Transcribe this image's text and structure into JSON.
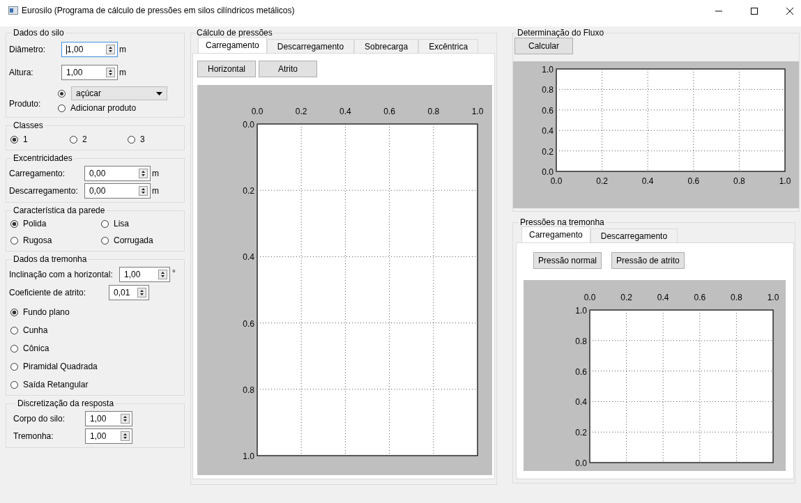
{
  "window": {
    "title": "Eurosilo (Programa de cálculo de pressões em silos cilíndricos metálicos)"
  },
  "dados_do_silo": {
    "title": "Dados do silo",
    "fields": [
      {
        "label": "Diâmetro:",
        "value": "1,00",
        "unit": "m",
        "focused": true
      },
      {
        "label": "Altura:",
        "value": "1,00",
        "unit": "m",
        "focused": false
      }
    ],
    "produto": {
      "label": "Produto:",
      "options": [
        {
          "kind": "dropdown",
          "value": "açúcar",
          "selected": true
        },
        {
          "kind": "radio",
          "label": "Adicionar produto",
          "selected": false
        }
      ]
    }
  },
  "classes": {
    "title": "Classes",
    "options": [
      {
        "label": "1",
        "selected": true
      },
      {
        "label": "2",
        "selected": false
      },
      {
        "label": "3",
        "selected": false
      }
    ]
  },
  "excentricidades": {
    "title": "Excentricidades",
    "fields": [
      {
        "label": "Carregamento:",
        "value": "0,00",
        "unit": "m"
      },
      {
        "label": "Descarregamento:",
        "value": "0,00",
        "unit": "m"
      }
    ]
  },
  "parede": {
    "title": "Característica da parede",
    "options": [
      {
        "label": "Polida",
        "selected": true
      },
      {
        "label": "Lisa",
        "selected": false
      },
      {
        "label": "Rugosa",
        "selected": false
      },
      {
        "label": "Corrugada",
        "selected": false
      }
    ]
  },
  "tremonha": {
    "title": "Dados da tremonha",
    "fields": [
      {
        "label": "Inclinação com a horizontal:",
        "value": "1,00",
        "unit": "°"
      },
      {
        "label": "Coeficiente de atrito:",
        "value": "0,01"
      }
    ],
    "options": [
      {
        "label": "Fundo plano",
        "selected": true
      },
      {
        "label": "Cunha",
        "selected": false
      },
      {
        "label": "Cônica",
        "selected": false
      },
      {
        "label": "Piramidal Quadrada",
        "selected": false
      },
      {
        "label": "Saída Retangular",
        "selected": false
      }
    ]
  },
  "discretizacao": {
    "title": "Discretização da resposta",
    "fields": [
      {
        "label": "Corpo do silo:",
        "value": "1,00"
      },
      {
        "label": "Tremonha:",
        "value": "1,00"
      }
    ]
  },
  "calculo": {
    "title": "Cálculo de pressões",
    "tabs": [
      {
        "label": "Carregamento",
        "selected": true
      },
      {
        "label": "Descarregamento",
        "selected": false
      },
      {
        "label": "Sobrecarga",
        "selected": false
      },
      {
        "label": "Excêntrica",
        "selected": false
      }
    ],
    "buttons": [
      "Horizontal",
      "Atrito"
    ],
    "chart_data": {
      "type": "line",
      "grid": true,
      "xlim": [
        0,
        1
      ],
      "ylim": [
        1,
        0
      ],
      "xticks": [
        {
          "value": 0,
          "label": "0.0"
        },
        {
          "value": 0.2,
          "label": "0.2"
        },
        {
          "value": 0.4,
          "label": "0.4"
        },
        {
          "value": 0.6,
          "label": "0.6"
        },
        {
          "value": 0.8,
          "label": "0.8"
        },
        {
          "value": 1,
          "label": "1.0"
        }
      ],
      "yticks": [
        {
          "value": 0,
          "label": "0.0"
        },
        {
          "value": 0.2,
          "label": "0.2"
        },
        {
          "value": 0.4,
          "label": "0.4"
        },
        {
          "value": 0.6,
          "label": "0.6"
        },
        {
          "value": 0.8,
          "label": "0.8"
        },
        {
          "value": 1,
          "label": "1.0"
        }
      ]
    }
  },
  "fluxo": {
    "title": "Determinação do Fluxo",
    "buttons": [
      "Calcular"
    ],
    "chart_data": {
      "type": "line",
      "grid": true,
      "xlim": [
        0,
        1
      ],
      "ylim": [
        0,
        1
      ],
      "xticks": [
        {
          "value": 0,
          "label": "0.0"
        },
        {
          "value": 0.2,
          "label": "0.2"
        },
        {
          "value": 0.4,
          "label": "0.4"
        },
        {
          "value": 0.6,
          "label": "0.6"
        },
        {
          "value": 0.8,
          "label": "0.8"
        },
        {
          "value": 1,
          "label": "1.0"
        }
      ],
      "yticks": [
        {
          "value": 0,
          "label": "0.0"
        },
        {
          "value": 0.2,
          "label": "0.2"
        },
        {
          "value": 0.4,
          "label": "0.4"
        },
        {
          "value": 0.6,
          "label": "0.6"
        },
        {
          "value": 0.8,
          "label": "0.8"
        },
        {
          "value": 1,
          "label": "1.0"
        }
      ]
    }
  },
  "pressoes_tremonha": {
    "title": "Pressões na tremonha",
    "tabs": [
      {
        "label": "Carregamento",
        "selected": true
      },
      {
        "label": "Descarregamento",
        "selected": false
      }
    ],
    "buttons": [
      "Pressão normal",
      "Pressão de atrito"
    ],
    "chart_data": {
      "type": "line",
      "grid": true,
      "xlim": [
        0,
        1
      ],
      "ylim": [
        0,
        1
      ],
      "xticks": [
        {
          "value": 0,
          "label": "0.0"
        },
        {
          "value": 0.2,
          "label": "0.2"
        },
        {
          "value": 0.4,
          "label": "0.4"
        },
        {
          "value": 0.6,
          "label": "0.6"
        },
        {
          "value": 0.8,
          "label": "0.8"
        },
        {
          "value": 1,
          "label": "1.0"
        }
      ],
      "yticks": [
        {
          "value": 0,
          "label": "0.0"
        },
        {
          "value": 0.2,
          "label": "0.2"
        },
        {
          "value": 0.4,
          "label": "0.4"
        },
        {
          "value": 0.6,
          "label": "0.6"
        },
        {
          "value": 0.8,
          "label": "0.8"
        },
        {
          "value": 1,
          "label": "1.0"
        }
      ]
    }
  }
}
